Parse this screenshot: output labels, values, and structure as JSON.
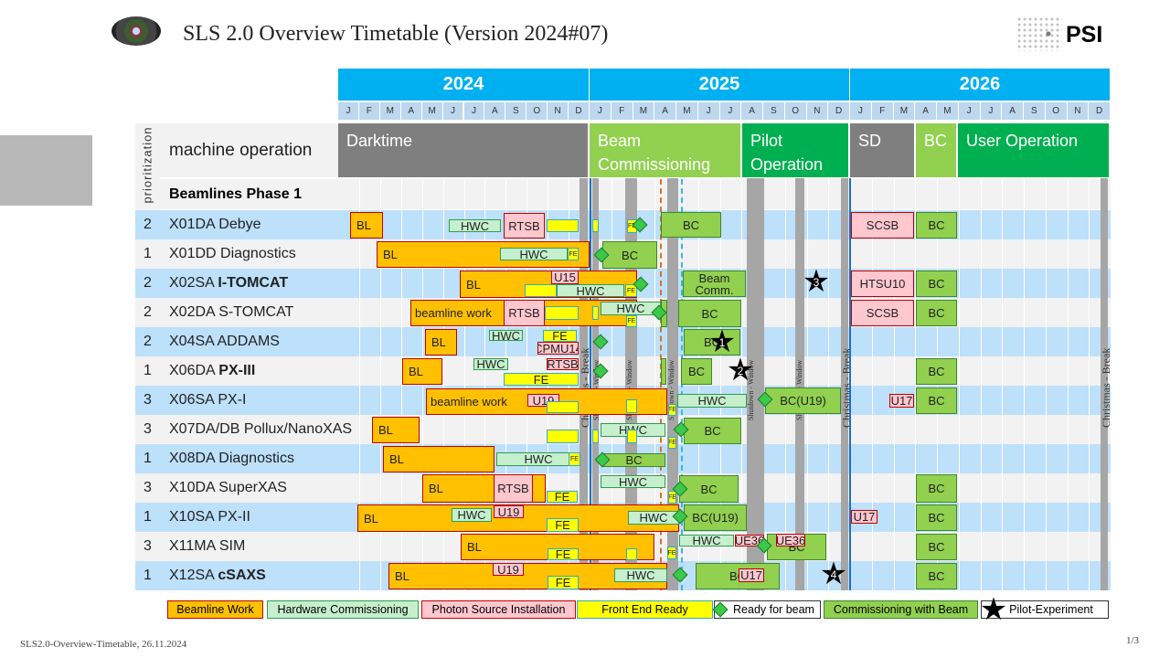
{
  "header": {
    "title": "SLS 2.0  Overview Timetable  (Version 2024#07)",
    "brand": "PSI"
  },
  "years": [
    "2024",
    "2025",
    "2026"
  ],
  "months": [
    "J",
    "F",
    "M",
    "A",
    "M",
    "J",
    "J",
    "A",
    "S",
    "O",
    "N",
    "D"
  ],
  "table": {
    "prioritization_label": "prioritization",
    "machine_operation_label": "machine operation",
    "phase_label": "Beamlines Phase 1"
  },
  "machine_operation": [
    {
      "label": "Darktime",
      "color": "#7f7f7f"
    },
    {
      "label": "Beam Commissioning",
      "color": "#92d050"
    },
    {
      "label": "Pilot Operation",
      "color": "#00b050"
    },
    {
      "label": "SD",
      "color": "#7f7f7f"
    },
    {
      "label": "BC",
      "color": "#92d050"
    },
    {
      "label": "User Operation",
      "color": "#00b050"
    }
  ],
  "overlays": {
    "christmas": "Christmas - Break",
    "shutdown": "Shutdown - Window"
  },
  "rows": [
    {
      "priority": "2",
      "name": "X01DA Debye",
      "bold": "",
      "bars": [
        {
          "label": "BL",
          "type": "BL"
        },
        {
          "label": "HWC",
          "type": "HWC"
        },
        {
          "label": "RTSB",
          "type": "PINK"
        },
        {
          "label": "",
          "type": "FE"
        },
        {
          "label": "",
          "type": "FE"
        },
        {
          "label": "FE",
          "type": "FEs"
        },
        {
          "label": "BC",
          "type": "BC"
        },
        {
          "label": "SCSB",
          "type": "PINK"
        },
        {
          "label": "BC",
          "type": "BC"
        }
      ]
    },
    {
      "priority": "1",
      "name": "X01DD Diagnostics",
      "bold": "",
      "bars": [
        {
          "label": "BL",
          "type": "BL"
        },
        {
          "label": "HWC",
          "type": "HWC"
        },
        {
          "label": "FE",
          "type": "FEs"
        },
        {
          "label": "BC",
          "type": "BC"
        }
      ]
    },
    {
      "priority": "2",
      "name": "X02SA ",
      "bold": "I-TOMCAT",
      "bars": [
        {
          "label": "BL",
          "type": "BL"
        },
        {
          "label": "U15",
          "type": "PINK"
        },
        {
          "label": "",
          "type": "FE"
        },
        {
          "label": "HWC",
          "type": "HWC"
        },
        {
          "label": "FE",
          "type": "FEs"
        },
        {
          "label": "Beam Comm.",
          "type": "BC"
        },
        {
          "label": "HTSU10",
          "type": "PINK"
        },
        {
          "label": "BC",
          "type": "BC"
        }
      ]
    },
    {
      "priority": "2",
      "name": "X02DA S-TOMCAT",
      "bold": "",
      "bars": [
        {
          "label": "beamline work",
          "type": "BL"
        },
        {
          "label": "RTSB",
          "type": "PINK"
        },
        {
          "label": "",
          "type": "FE"
        },
        {
          "label": "",
          "type": "FE"
        },
        {
          "label": "HWC",
          "type": "HWC"
        },
        {
          "label": "FE",
          "type": "FEs"
        },
        {
          "label": "",
          "type": "BC"
        },
        {
          "label": "BC",
          "type": "BC"
        },
        {
          "label": "SCSB",
          "type": "PINK"
        },
        {
          "label": "BC",
          "type": "BC"
        }
      ]
    },
    {
      "priority": "2",
      "name": "X04SA ADDAMS",
      "bold": "",
      "bars": [
        {
          "label": "BL",
          "type": "BL"
        },
        {
          "label": "HWC",
          "type": "HWC"
        },
        {
          "label": "FE",
          "type": "FE"
        },
        {
          "label": "CPMU14",
          "type": "PINK"
        },
        {
          "label": "BC",
          "type": "BC"
        }
      ]
    },
    {
      "priority": "1",
      "name": "X06DA ",
      "bold": "PX-III",
      "bars": [
        {
          "label": "BL",
          "type": "BL"
        },
        {
          "label": "HWC",
          "type": "HWC"
        },
        {
          "label": "RTSB",
          "type": "PINK"
        },
        {
          "label": "FE",
          "type": "FE"
        },
        {
          "label": "",
          "type": "BC"
        },
        {
          "label": "BC",
          "type": "BC"
        },
        {
          "label": "BC",
          "type": "BC"
        }
      ]
    },
    {
      "priority": "3",
      "name": "X06SA PX-I",
      "bold": "",
      "bars": [
        {
          "label": "beamline work",
          "type": "BL"
        },
        {
          "label": "U19",
          "type": "PINK"
        },
        {
          "label": "",
          "type": "FE"
        },
        {
          "label": "",
          "type": "FE"
        },
        {
          "label": "FE",
          "type": "FEs"
        },
        {
          "label": "HWC",
          "type": "HWC"
        },
        {
          "label": "BC(U19)",
          "type": "BC"
        },
        {
          "label": "U17",
          "type": "PINK"
        },
        {
          "label": "BC",
          "type": "BC"
        }
      ]
    },
    {
      "priority": "3",
      "name": "X07DA/DB Pollux/NanoXAS",
      "bold": "",
      "bars": [
        {
          "label": "BL",
          "type": "BL"
        },
        {
          "label": "",
          "type": "FE"
        },
        {
          "label": "",
          "type": "FE"
        },
        {
          "label": "HWC",
          "type": "HWC"
        },
        {
          "label": "",
          "type": "FE"
        },
        {
          "label": "FE",
          "type": "FEs"
        },
        {
          "label": "BC",
          "type": "BC"
        }
      ]
    },
    {
      "priority": "1",
      "name": "X08DA Diagnostics",
      "bold": "",
      "bars": [
        {
          "label": "BL",
          "type": "BL"
        },
        {
          "label": "HWC",
          "type": "HWC"
        },
        {
          "label": "FE",
          "type": "FEs"
        },
        {
          "label": "BC",
          "type": "BC"
        }
      ]
    },
    {
      "priority": "3",
      "name": "X10DA SuperXAS",
      "bold": "",
      "bars": [
        {
          "label": "BL",
          "type": "BL"
        },
        {
          "label": "RTSB",
          "type": "PINK"
        },
        {
          "label": "FE",
          "type": "FE"
        },
        {
          "label": "HWC",
          "type": "HWC"
        },
        {
          "label": "FE",
          "type": "FEs"
        },
        {
          "label": "BC",
          "type": "BC"
        },
        {
          "label": "BC",
          "type": "BC"
        }
      ]
    },
    {
      "priority": "1",
      "name": "X10SA PX-II",
      "bold": "",
      "bars": [
        {
          "label": "BL",
          "type": "BL"
        },
        {
          "label": "HWC",
          "type": "HWC"
        },
        {
          "label": "U19",
          "type": "PINK"
        },
        {
          "label": "FE",
          "type": "FE"
        },
        {
          "label": "HWC",
          "type": "HWC"
        },
        {
          "label": "BC(U19)",
          "type": "BC"
        },
        {
          "label": "U17",
          "type": "PINK"
        },
        {
          "label": "BC",
          "type": "BC"
        }
      ]
    },
    {
      "priority": "3",
      "name": "X11MA SIM",
      "bold": "",
      "bars": [
        {
          "label": "BL",
          "type": "BL"
        },
        {
          "label": "FE",
          "type": "FE"
        },
        {
          "label": "",
          "type": "FE"
        },
        {
          "label": "FE",
          "type": "FEs"
        },
        {
          "label": "HWC",
          "type": "HWC"
        },
        {
          "label": "UE36",
          "type": "PINK"
        },
        {
          "label": "BC",
          "type": "BC"
        },
        {
          "label": "UE36",
          "type": "PINK"
        },
        {
          "label": "BC",
          "type": "BC"
        }
      ]
    },
    {
      "priority": "1",
      "name": "X12SA ",
      "bold": "cSAXS",
      "bars": [
        {
          "label": "BL",
          "type": "BL"
        },
        {
          "label": "U19",
          "type": "PINK"
        },
        {
          "label": "FE",
          "type": "FE"
        },
        {
          "label": "HWC",
          "type": "HWC"
        },
        {
          "label": "BC",
          "type": "BC"
        },
        {
          "label": "U17",
          "type": "PINK"
        },
        {
          "label": "BC",
          "type": "BC"
        }
      ]
    }
  ],
  "stars": [
    "1",
    "2",
    "3",
    "4"
  ],
  "legend": [
    {
      "label": "Beamline Work",
      "type": "BL"
    },
    {
      "label": "Hardware Commissioning",
      "type": "HWC"
    },
    {
      "label": "Photon Source Installation",
      "type": "PINK"
    },
    {
      "label": "Front End Ready",
      "type": "FE"
    },
    {
      "label": "Ready for beam",
      "type": "diamond"
    },
    {
      "label": "Commissioning with Beam",
      "type": "BC"
    },
    {
      "label": "Pilot-Experiment",
      "type": "star"
    }
  ],
  "footer": {
    "doc": "SLS2.0-Overview-Timetable, 26.11.2024",
    "page": "1/3"
  }
}
